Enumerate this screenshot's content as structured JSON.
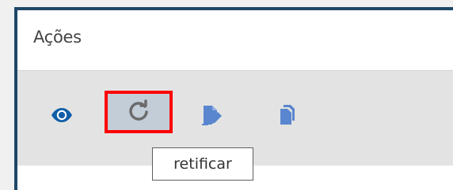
{
  "panel": {
    "title": "Ações"
  },
  "toolbar": {
    "actions": [
      {
        "name": "view",
        "icon": "eye-icon"
      },
      {
        "name": "retify",
        "icon": "redo-icon",
        "highlighted": true
      },
      {
        "name": "sign",
        "icon": "sign-document-icon"
      },
      {
        "name": "copy",
        "icon": "copy-icon"
      }
    ],
    "tooltip": "retificar"
  },
  "colors": {
    "frame": "#1d4767",
    "toolbar_bg": "#e3e3e3",
    "icon_primary": "#0f5ea7",
    "icon_secondary": "#5a86cf",
    "highlight": "#ff0000",
    "active_button_bg": "#c3cdd8"
  }
}
